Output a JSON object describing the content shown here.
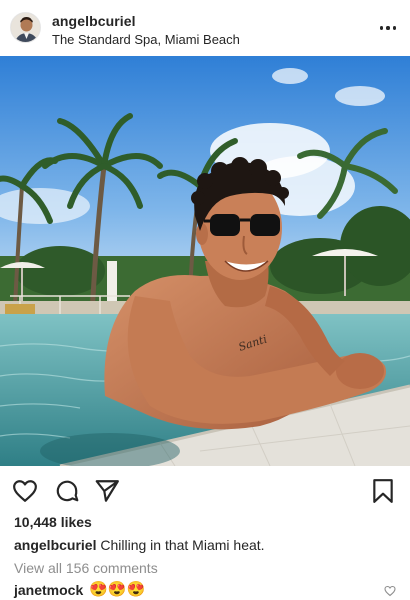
{
  "post": {
    "username": "angelbcuriel",
    "location": "The Standard Spa, Miami Beach",
    "likes": "10,448 likes",
    "caption": {
      "username": "angelbcuriel",
      "text": "Chilling in that Miami heat."
    },
    "view_all_comments": "View all 156 comments",
    "comment": {
      "username": "janetmock",
      "text": "😍😍😍"
    }
  },
  "icons": {
    "more": "more-options-icon",
    "like": "heart-icon",
    "comment": "comment-icon",
    "share": "share-icon",
    "save": "bookmark-icon",
    "comment_like": "small-heart-icon"
  },
  "colors": {
    "text": "#262626",
    "muted": "#8e8e8e",
    "background": "#ffffff"
  }
}
